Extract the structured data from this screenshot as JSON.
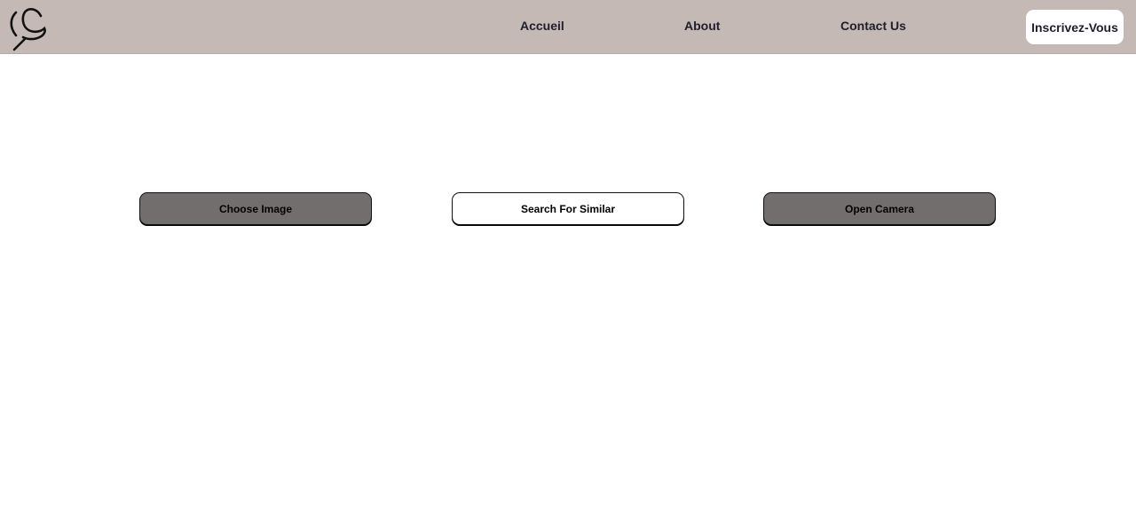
{
  "nav": {
    "links": [
      {
        "label": "Accueil"
      },
      {
        "label": "About"
      },
      {
        "label": "Contact Us"
      }
    ],
    "signup_label": "Inscrivez-Vous",
    "logo_icon": "cs-monogram-logo-icon"
  },
  "main": {
    "choose_image_label": "Choose Image",
    "search_similar_label": "Search For Similar",
    "open_camera_label": "Open Camera"
  },
  "colors": {
    "navbar_bg": "#c4b9b4",
    "primary_button_bg": "#726e6d",
    "secondary_button_bg": "#ffffff",
    "nav_text": "#1f1f2b"
  }
}
